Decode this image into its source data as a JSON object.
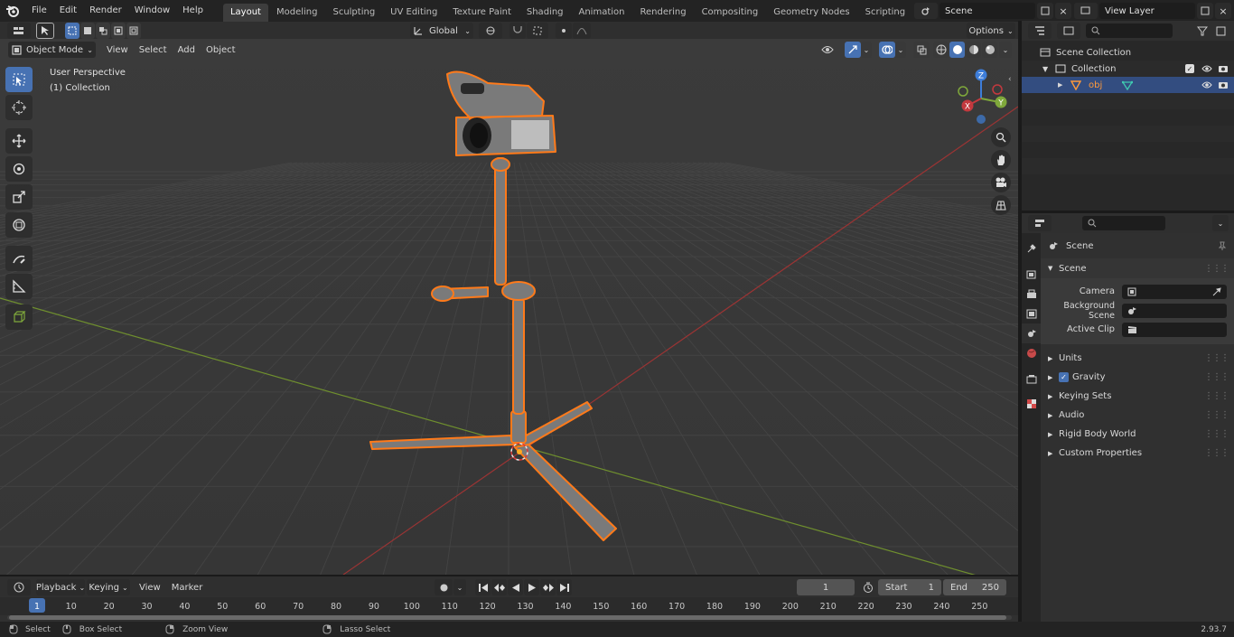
{
  "menu": {
    "file": "File",
    "edit": "Edit",
    "render": "Render",
    "window": "Window",
    "help": "Help"
  },
  "workspaces": [
    "Layout",
    "Modeling",
    "Sculpting",
    "UV Editing",
    "Texture Paint",
    "Shading",
    "Animation",
    "Rendering",
    "Compositing",
    "Geometry Nodes",
    "Scripting"
  ],
  "active_workspace": "Layout",
  "scene_field": "Scene",
  "view_layer_field": "View Layer",
  "viewport": {
    "mode": "Object Mode",
    "menus": {
      "view": "View",
      "select": "Select",
      "add": "Add",
      "object": "Object"
    },
    "orientation": "Global",
    "options": "Options",
    "info_line1": "User Perspective",
    "info_line2": "(1) Collection",
    "gizmo": {
      "x": "X",
      "y": "Y",
      "z": "Z"
    }
  },
  "outliner": {
    "scene_collection": "Scene Collection",
    "collection": "Collection",
    "object": "obj"
  },
  "properties": {
    "context": "Scene",
    "panel_title": "Scene",
    "camera_label": "Camera",
    "background_scene_label": "Background Scene",
    "active_clip_label": "Active Clip",
    "sections": [
      "Units",
      "Gravity",
      "Keying Sets",
      "Audio",
      "Rigid Body World",
      "Custom Properties"
    ]
  },
  "timeline": {
    "menus": {
      "playback": "Playback",
      "keying": "Keying",
      "view": "View",
      "marker": "Marker"
    },
    "current_frame": "1",
    "start_label": "Start",
    "start_value": "1",
    "end_label": "End",
    "end_value": "250",
    "ticks": [
      "1",
      "10",
      "20",
      "30",
      "40",
      "50",
      "60",
      "70",
      "80",
      "90",
      "100",
      "110",
      "120",
      "130",
      "140",
      "150",
      "160",
      "170",
      "180",
      "190",
      "200",
      "210",
      "220",
      "230",
      "240",
      "250"
    ]
  },
  "status": {
    "select": "Select",
    "box_select": "Box Select",
    "zoom_view": "Zoom View",
    "lasso_select": "Lasso Select",
    "version": "2.93.7"
  },
  "colors": {
    "accent": "#4772b3",
    "selection_outline": "#ff7a1a",
    "x_axis": "#c3393e",
    "y_axis": "#7fa83b",
    "z_axis": "#3d7dd9"
  }
}
